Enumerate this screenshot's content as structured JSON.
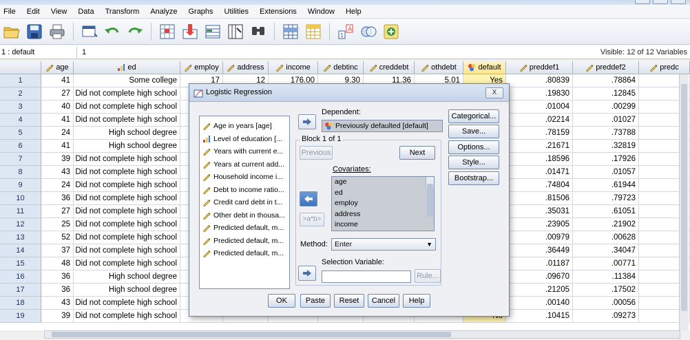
{
  "menu": [
    "File",
    "Edit",
    "View",
    "Data",
    "Transform",
    "Analyze",
    "Graphs",
    "Utilities",
    "Extensions",
    "Window",
    "Help"
  ],
  "toolbar_icons": [
    "open-file-icon",
    "save-icon",
    "print-icon",
    "dialog-recall-icon",
    "undo-icon",
    "redo-icon",
    "goto-case-icon",
    "goto-variable-icon",
    "variables-icon",
    "run-descriptives-icon",
    "find-icon",
    "insert-cases-icon",
    "insert-variable-icon",
    "split-file-icon",
    "select-cases-icon",
    "value-labels-icon"
  ],
  "cellbar": {
    "cell_name": "1 : default",
    "cell_value": "1",
    "visible": "Visible: 12 of 12 Variables"
  },
  "columns": [
    {
      "name": "age",
      "type": "scale"
    },
    {
      "name": "ed",
      "type": "ordinal"
    },
    {
      "name": "employ",
      "type": "scale"
    },
    {
      "name": "address",
      "type": "scale"
    },
    {
      "name": "income",
      "type": "scale"
    },
    {
      "name": "debtinc",
      "type": "scale"
    },
    {
      "name": "creddebt",
      "type": "scale"
    },
    {
      "name": "othdebt",
      "type": "scale"
    },
    {
      "name": "default",
      "type": "nominal"
    },
    {
      "name": "preddef1",
      "type": "scale"
    },
    {
      "name": "preddef2",
      "type": "scale"
    },
    {
      "name": "predc",
      "type": "scale"
    }
  ],
  "rows": [
    {
      "n": "1",
      "age": "41",
      "ed": "Some college",
      "employ": "17",
      "address": "12",
      "income": "176.00",
      "debtinc": "9.30",
      "creddebt": "11.36",
      "othdebt": "5.01",
      "default": "Yes",
      "preddef1": ".80839",
      "preddef2": ".78864"
    },
    {
      "n": "2",
      "age": "27",
      "ed": "Did not complete high school",
      "preddef1": ".19830",
      "preddef2": ".12845"
    },
    {
      "n": "3",
      "age": "40",
      "ed": "Did not complete high school",
      "preddef1": ".01004",
      "preddef2": ".00299"
    },
    {
      "n": "4",
      "age": "41",
      "ed": "Did not complete high school",
      "preddef1": ".02214",
      "preddef2": ".01027"
    },
    {
      "n": "5",
      "age": "24",
      "ed": "High school degree",
      "preddef1": ".78159",
      "preddef2": ".73788"
    },
    {
      "n": "6",
      "age": "41",
      "ed": "High school degree",
      "preddef1": ".21671",
      "preddef2": ".32819"
    },
    {
      "n": "7",
      "age": "39",
      "ed": "Did not complete high school",
      "preddef1": ".18596",
      "preddef2": ".17926"
    },
    {
      "n": "8",
      "age": "43",
      "ed": "Did not complete high school",
      "preddef1": ".01471",
      "preddef2": ".01057"
    },
    {
      "n": "9",
      "age": "24",
      "ed": "Did not complete high school",
      "preddef1": ".74804",
      "preddef2": ".61944"
    },
    {
      "n": "10",
      "age": "36",
      "ed": "Did not complete high school",
      "preddef1": ".81506",
      "preddef2": ".79723"
    },
    {
      "n": "11",
      "age": "27",
      "ed": "Did not complete high school",
      "preddef1": ".35031",
      "preddef2": ".61051"
    },
    {
      "n": "12",
      "age": "25",
      "ed": "Did not complete high school",
      "preddef1": ".23905",
      "preddef2": ".21902"
    },
    {
      "n": "13",
      "age": "52",
      "ed": "Did not complete high school",
      "preddef1": ".00979",
      "preddef2": ".00628"
    },
    {
      "n": "14",
      "age": "37",
      "ed": "Did not complete high school",
      "preddef1": ".36449",
      "preddef2": ".34047"
    },
    {
      "n": "15",
      "age": "48",
      "ed": "Did not complete high school",
      "preddef1": ".01187",
      "preddef2": ".00771"
    },
    {
      "n": "16",
      "age": "36",
      "ed": "High school degree",
      "preddef1": ".09670",
      "preddef2": ".11384"
    },
    {
      "n": "17",
      "age": "36",
      "ed": "High school degree",
      "preddef1": ".21205",
      "preddef2": ".17502"
    },
    {
      "n": "18",
      "age": "43",
      "ed": "Did not complete high school",
      "preddef1": ".00140",
      "preddef2": ".00056"
    },
    {
      "n": "19",
      "age": "39",
      "ed": "Did not complete high school",
      "default": "No",
      "preddef1": ".10415",
      "preddef2": ".09273"
    }
  ],
  "dialog": {
    "title": "Logistic Regression",
    "close": "X",
    "variables": [
      {
        "label": "Age in years [age]",
        "type": "scale"
      },
      {
        "label": "Level of education [...",
        "type": "ordinal"
      },
      {
        "label": "Years with current e...",
        "type": "scale"
      },
      {
        "label": "Years at current add...",
        "type": "scale"
      },
      {
        "label": "Household income i...",
        "type": "scale"
      },
      {
        "label": "Debt to income ratio...",
        "type": "scale"
      },
      {
        "label": "Credit card debt in t...",
        "type": "scale"
      },
      {
        "label": "Other debt in thousa...",
        "type": "scale"
      },
      {
        "label": "Predicted default, m...",
        "type": "scale"
      },
      {
        "label": "Predicted default, m...",
        "type": "scale"
      },
      {
        "label": "Predicted default, m...",
        "type": "scale"
      }
    ],
    "dependent_label": "Dependent:",
    "dependent_value": "Previously defaulted [default]",
    "block_label": "Block 1 of 1",
    "previous": "Previous",
    "next": "Next",
    "covariates_label": "Covariates:",
    "covariates": [
      "age",
      "ed",
      "employ",
      "address",
      "income"
    ],
    "interaction": ">a*b>",
    "method_label": "Method:",
    "method_value": "Enter",
    "selection_label": "Selection Variable:",
    "rule": "Rule...",
    "side_buttons": [
      "Categorical...",
      "Save...",
      "Options...",
      "Style...",
      "Bootstrap..."
    ],
    "bottom_buttons": [
      "OK",
      "Paste",
      "Reset",
      "Cancel",
      "Help"
    ]
  }
}
